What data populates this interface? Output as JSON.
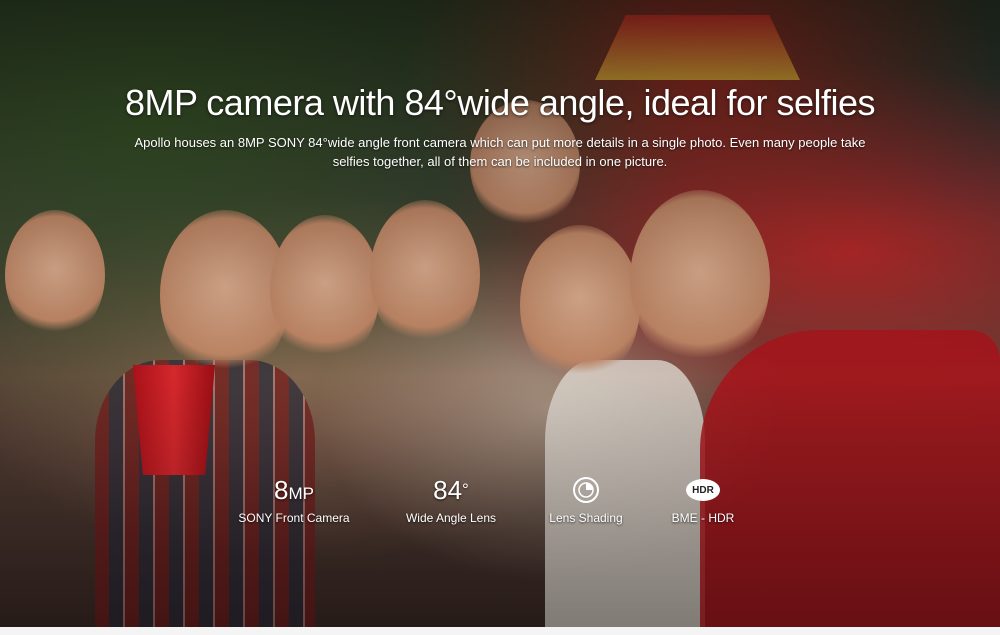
{
  "banner": {
    "heading": "8MP camera with 84°wide angle, ideal for selfies",
    "description_line1": "Apollo houses an 8MP SONY 84°wide angle front camera which can put more details in a single photo. Even many people take",
    "description_line2": "selfies together, all of them can be included in one picture."
  },
  "features": [
    {
      "value": "8",
      "unit": "MP",
      "label": "SONY Front Camera"
    },
    {
      "value": "84",
      "unit": "°",
      "label": "Wide Angle Lens"
    },
    {
      "icon": "lens-shading-icon",
      "label": "Lens Shading"
    },
    {
      "icon": "hdr-icon",
      "icon_text": "HDR",
      "label": "BME - HDR"
    }
  ]
}
